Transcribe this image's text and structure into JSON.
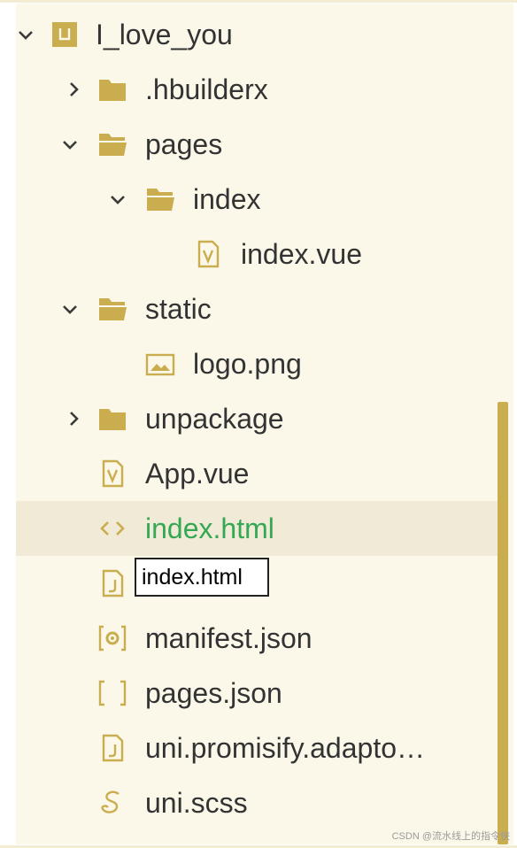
{
  "colors": {
    "icon": "#c9ad4e",
    "text": "#333333",
    "selected": "#34a853",
    "panel": "#fbf8ea"
  },
  "tree": {
    "items": [
      {
        "label": "I_love_you",
        "icon": "project-icon",
        "chevron": "chevron-down-icon"
      },
      {
        "label": ".hbuilderx",
        "icon": "folder-icon",
        "chevron": "chevron-right-icon"
      },
      {
        "label": "pages",
        "icon": "folder-open-icon",
        "chevron": "chevron-down-icon"
      },
      {
        "label": "index",
        "icon": "folder-open-icon",
        "chevron": "chevron-down-icon"
      },
      {
        "label": "index.vue",
        "icon": "vue-file-icon"
      },
      {
        "label": "static",
        "icon": "folder-open-icon",
        "chevron": "chevron-down-icon"
      },
      {
        "label": "logo.png",
        "icon": "image-file-icon"
      },
      {
        "label": "unpackage",
        "icon": "folder-icon",
        "chevron": "chevron-right-icon"
      },
      {
        "label": "App.vue",
        "icon": "vue-file-icon"
      },
      {
        "label": "index.html",
        "icon": "html-file-icon",
        "selected": true
      },
      {
        "label": "",
        "icon": "js-file-icon",
        "renaming": true
      },
      {
        "label": "manifest.json",
        "icon": "settings-file-icon"
      },
      {
        "label": "pages.json",
        "icon": "json-file-icon"
      },
      {
        "label": "uni.promisify.adapto…",
        "icon": "js-file-icon"
      },
      {
        "label": "uni.scss",
        "icon": "scss-file-icon"
      }
    ]
  },
  "rename": {
    "value": "index.html"
  },
  "watermark": "CSDN @流水线上的指令侠"
}
